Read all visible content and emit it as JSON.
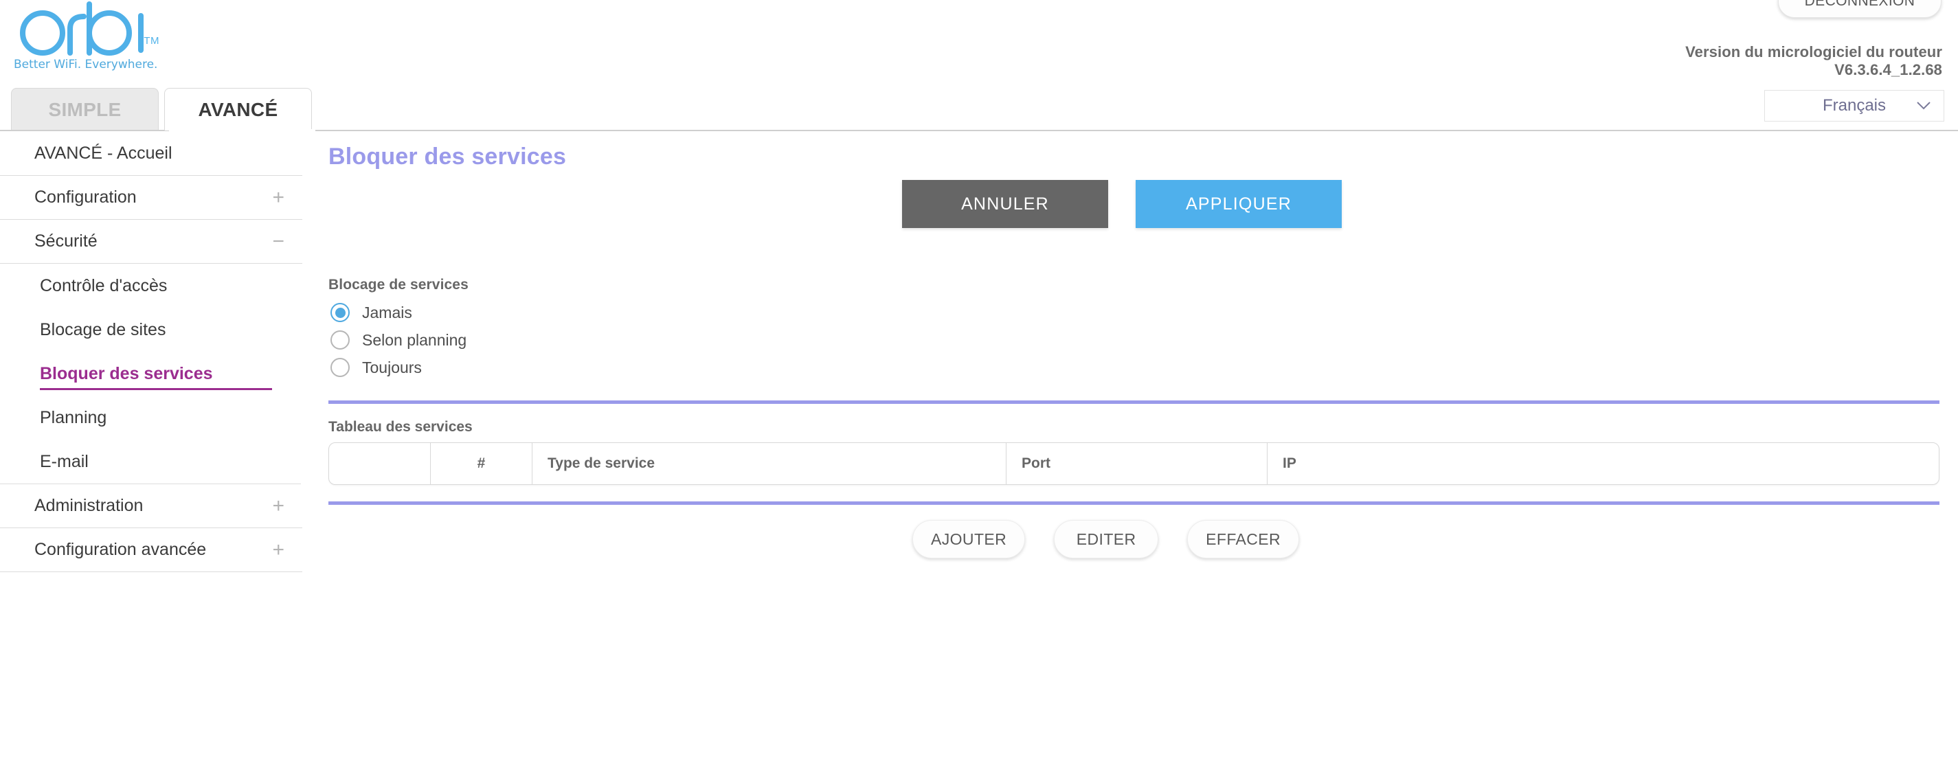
{
  "brand": {
    "name": "orbi",
    "trademark": "TM",
    "tagline": "Better WiFi. Everywhere.",
    "logo_color": "#4fb0e8"
  },
  "header": {
    "logout_label": "DÉCONNEXION",
    "firmware_label": "Version du micrologiciel du routeur",
    "firmware_version": "V6.3.6.4_1.2.68",
    "language_value": "Français",
    "language_chevron_icon": "chevron-down-icon"
  },
  "tabs": [
    {
      "label": "SIMPLE",
      "active": false
    },
    {
      "label": "AVANCÉ",
      "active": true
    }
  ],
  "sidebar": {
    "items": [
      {
        "label": "AVANCÉ - Accueil",
        "type": "item",
        "toggle": ""
      },
      {
        "label": "Configuration",
        "type": "item",
        "toggle": "+"
      },
      {
        "label": "Sécurité",
        "type": "item",
        "toggle": "−"
      },
      {
        "label": "Contrôle d'accès",
        "type": "sub",
        "active": false
      },
      {
        "label": "Blocage de sites",
        "type": "sub",
        "active": false
      },
      {
        "label": "Bloquer des services",
        "type": "sub",
        "active": true
      },
      {
        "label": "Planning",
        "type": "sub",
        "active": false
      },
      {
        "label": "E-mail",
        "type": "sub",
        "active": false
      },
      {
        "label": "Administration",
        "type": "item",
        "toggle": "+"
      },
      {
        "label": "Configuration avancée",
        "type": "item",
        "toggle": "+"
      }
    ],
    "active_color": "#9b2d8f"
  },
  "main": {
    "page_title": "Bloquer des services",
    "title_color": "#9a9aea",
    "cancel_label": "ANNULER",
    "apply_label": "APPLIQUER",
    "cancel_color": "#666666",
    "apply_color": "#4fb0ec",
    "blocking_section_label": "Blocage de services",
    "radio_options": [
      {
        "label": "Jamais",
        "selected": true
      },
      {
        "label": "Selon planning",
        "selected": false
      },
      {
        "label": "Toujours",
        "selected": false
      }
    ],
    "table_label": "Tableau des services",
    "table": {
      "columns": [
        "",
        "#",
        "Type de service",
        "Port",
        "IP"
      ],
      "rows": []
    },
    "table_buttons": [
      "AJOUTER",
      "EDITER",
      "EFFACER"
    ],
    "divider_color": "#9a9aea"
  }
}
